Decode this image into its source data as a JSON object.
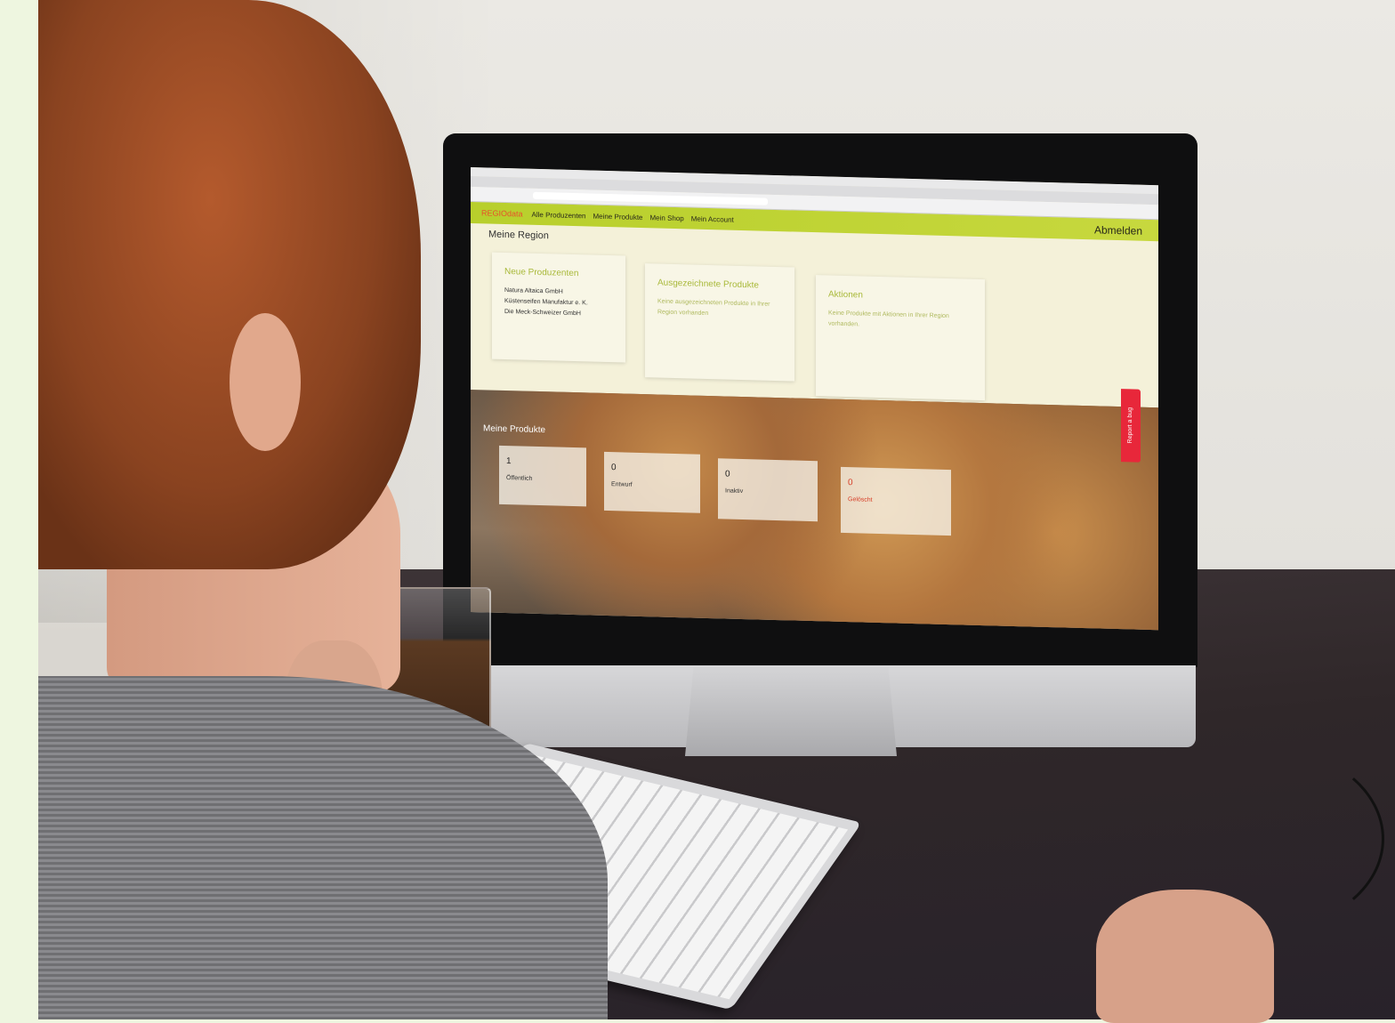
{
  "app": {
    "brand": "REGIOdata",
    "nav": [
      "Alle Produzenten",
      "Meine Produkte",
      "Mein Shop",
      "Mein Account"
    ],
    "logout_label": "Abmelden"
  },
  "region": {
    "title": "Meine Region",
    "cards": [
      {
        "title": "Neue Produzenten",
        "lines": [
          "Natura Altaica GmbH",
          "Küstenseifen Manufaktur e. K.",
          "Die Meck-Schweizer GmbH"
        ]
      },
      {
        "title": "Ausgezeichnete Produkte",
        "text": "Keine ausgezeichneten Produkte in Ihrer Region vorhanden"
      },
      {
        "title": "Aktionen",
        "text": "Keine Produkte mit Aktionen in Ihrer Region vorhanden."
      }
    ]
  },
  "products": {
    "title": "Meine Produkte",
    "stats": [
      {
        "value": "1",
        "label": "Öffentlich"
      },
      {
        "value": "0",
        "label": "Entwurf"
      },
      {
        "value": "0",
        "label": "Inaktiv"
      },
      {
        "value": "0",
        "label": "Gelöscht"
      }
    ]
  },
  "bug_report_label": "Report a bug",
  "colors": {
    "nav_green": "#c7d83e",
    "brand_red": "#e8502b",
    "bug_red": "#e8273a"
  }
}
